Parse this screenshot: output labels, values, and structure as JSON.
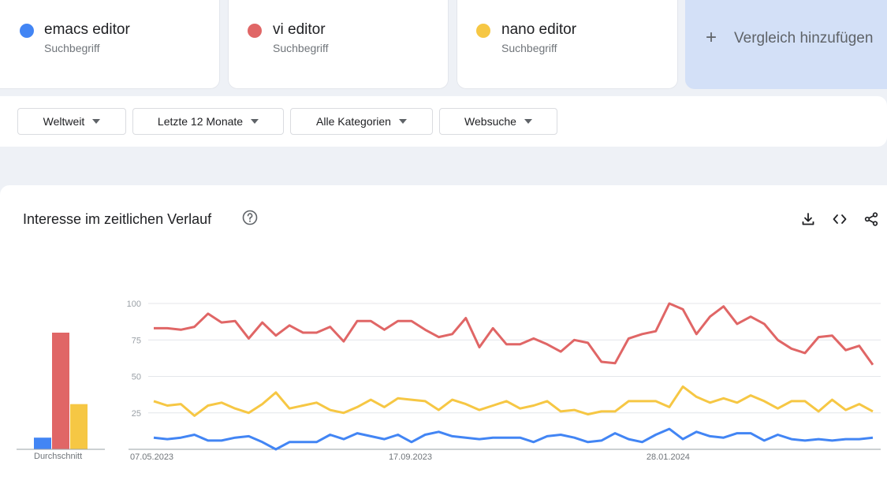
{
  "terms": [
    {
      "name": "emacs editor",
      "sub": "Suchbegriff",
      "color": "#4285f4"
    },
    {
      "name": "vi editor",
      "sub": "Suchbegriff",
      "color": "#e06666"
    },
    {
      "name": "nano editor",
      "sub": "Suchbegriff",
      "color": "#f6c744"
    }
  ],
  "add_compare": "Vergleich hinzufügen",
  "filters": [
    "Weltweit",
    "Letzte 12 Monate",
    "Alle Kategorien",
    "Websuche"
  ],
  "panel": {
    "title": "Interesse im zeitlichen Verlauf"
  },
  "icons": [
    "help-icon",
    "download-icon",
    "embed-code-icon",
    "share-icon"
  ],
  "chart_data": {
    "type": "line",
    "ylim": [
      0,
      100
    ],
    "yticks": [
      25,
      50,
      75,
      100
    ],
    "x_labels": [
      "07.05.2023",
      "17.09.2023",
      "28.01.2024"
    ],
    "x_label_index": [
      0,
      19,
      38
    ],
    "series": [
      {
        "name": "emacs editor",
        "color": "#4285f4",
        "values": [
          8,
          7,
          8,
          10,
          6,
          6,
          8,
          9,
          5,
          0,
          5,
          5,
          5,
          10,
          7,
          11,
          9,
          7,
          10,
          5,
          10,
          12,
          9,
          8,
          7,
          8,
          8,
          8,
          5,
          9,
          10,
          8,
          5,
          6,
          11,
          7,
          5,
          10,
          14,
          7,
          12,
          9,
          8,
          11,
          11,
          6,
          10,
          7,
          6,
          7,
          6,
          7,
          7,
          8
        ]
      },
      {
        "name": "vi editor",
        "color": "#e06666",
        "values": [
          83,
          83,
          82,
          84,
          93,
          87,
          88,
          76,
          87,
          78,
          85,
          80,
          80,
          84,
          74,
          88,
          88,
          82,
          88,
          88,
          82,
          77,
          79,
          90,
          70,
          83,
          72,
          72,
          76,
          72,
          67,
          75,
          73,
          60,
          59,
          76,
          79,
          81,
          100,
          96,
          79,
          91,
          98,
          86,
          91,
          86,
          75,
          69,
          66,
          77,
          78,
          68,
          71,
          58
        ]
      },
      {
        "name": "nano editor",
        "color": "#f6c744",
        "values": [
          33,
          30,
          31,
          23,
          30,
          32,
          28,
          25,
          31,
          39,
          28,
          30,
          32,
          27,
          25,
          29,
          34,
          29,
          35,
          34,
          33,
          27,
          34,
          31,
          27,
          30,
          33,
          28,
          30,
          33,
          26,
          27,
          24,
          26,
          26,
          33,
          33,
          33,
          29,
          43,
          36,
          32,
          35,
          32,
          37,
          33,
          28,
          33,
          33,
          26,
          34,
          27,
          31,
          26
        ]
      }
    ],
    "averages": {
      "label": "Durchschnitt",
      "values": [
        8,
        80,
        31
      ]
    },
    "grid": true
  }
}
